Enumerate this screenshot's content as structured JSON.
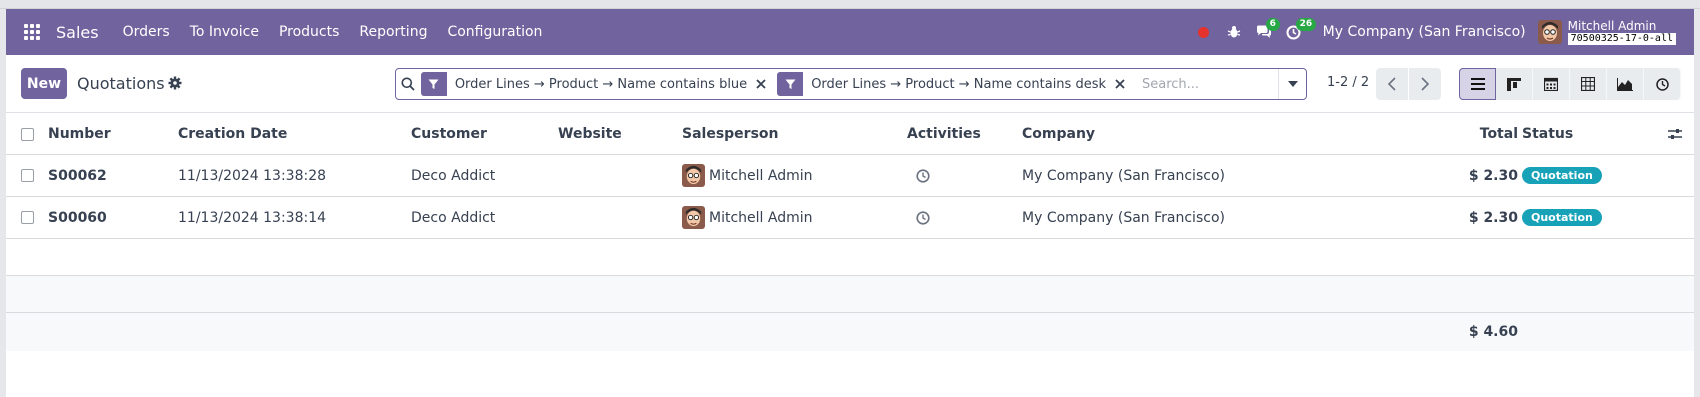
{
  "navbar": {
    "brand": "Sales",
    "menu": [
      "Orders",
      "To Invoice",
      "Products",
      "Reporting",
      "Configuration"
    ],
    "messages_count": "6",
    "activities_count": "26",
    "company": "My Company (San Francisco)",
    "user_name": "Mitchell Admin",
    "db_name": "70500325-17-0-all"
  },
  "control_panel": {
    "new_label": "New",
    "title": "Quotations",
    "facets": [
      "Order Lines → Product → Name contains blue",
      "Order Lines → Product → Name contains desk"
    ],
    "search_placeholder": "Search...",
    "pager": "1-2 / 2"
  },
  "table": {
    "columns": {
      "number": "Number",
      "creation_date": "Creation Date",
      "customer": "Customer",
      "website": "Website",
      "salesperson": "Salesperson",
      "activities": "Activities",
      "company": "Company",
      "total": "Total",
      "status": "Status"
    },
    "rows": [
      {
        "number": "S00062",
        "creation_date": "11/13/2024 13:38:28",
        "customer": "Deco Addict",
        "website": "",
        "salesperson": "Mitchell Admin",
        "company": "My Company (San Francisco)",
        "total": "$ 2.30",
        "status": "Quotation"
      },
      {
        "number": "S00060",
        "creation_date": "11/13/2024 13:38:14",
        "customer": "Deco Addict",
        "website": "",
        "salesperson": "Mitchell Admin",
        "company": "My Company (San Francisco)",
        "total": "$ 2.30",
        "status": "Quotation"
      }
    ],
    "grand_total": "$ 4.60"
  },
  "colors": {
    "brand": "#71639e",
    "status_badge": "#17a2b8",
    "notification_badge": "#28a745",
    "record_dot": "#e5322d"
  }
}
